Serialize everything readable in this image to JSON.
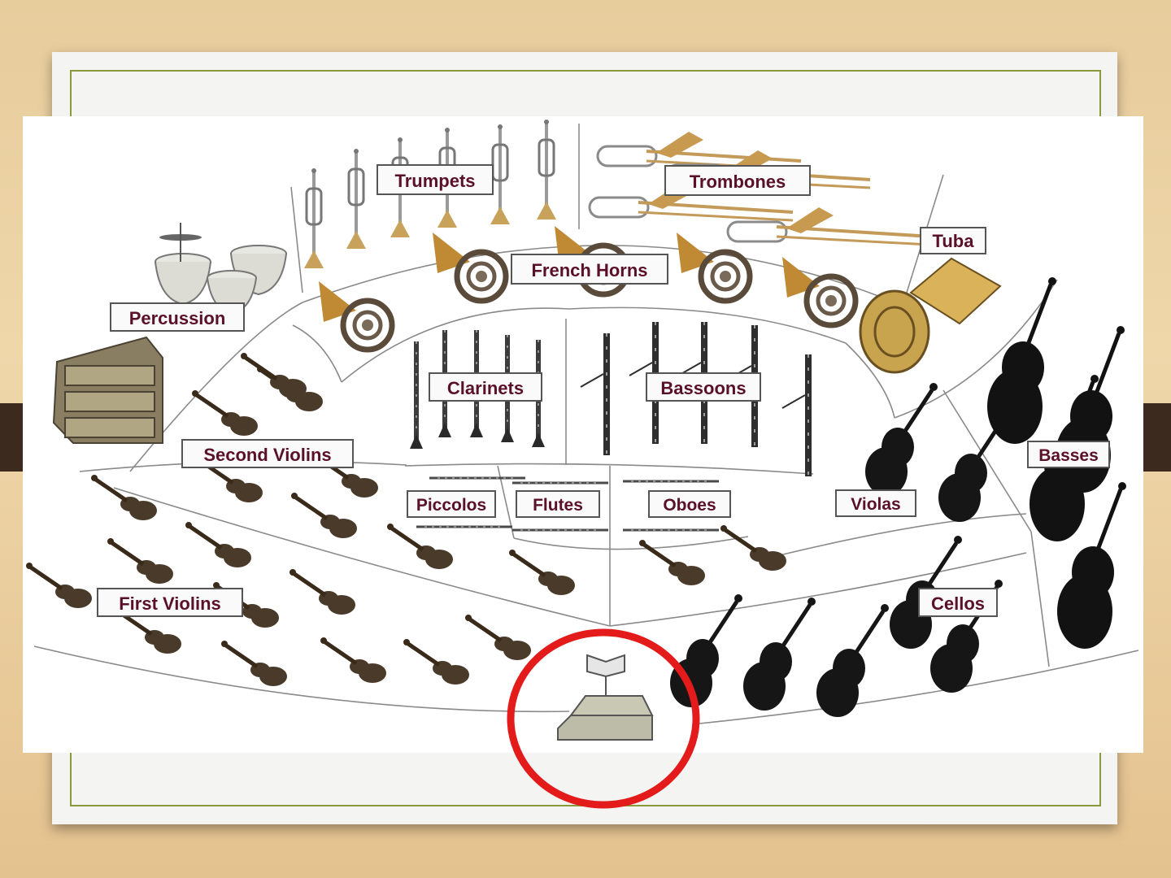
{
  "diagram": {
    "sections": {
      "trumpets": "Trumpets",
      "trombones": "Trombones",
      "tuba": "Tuba",
      "percussion": "Percussion",
      "french_horns": "French Horns",
      "clarinets": "Clarinets",
      "bassoons": "Bassoons",
      "second_violins": "Second Violins",
      "piccolos": "Piccolos",
      "flutes": "Flutes",
      "oboes": "Oboes",
      "violas": "Violas",
      "basses": "Basses",
      "first_violins": "First Violins",
      "cellos": "Cellos"
    },
    "highlight_color": "#e31b1b",
    "label_color": "#5a1028"
  }
}
